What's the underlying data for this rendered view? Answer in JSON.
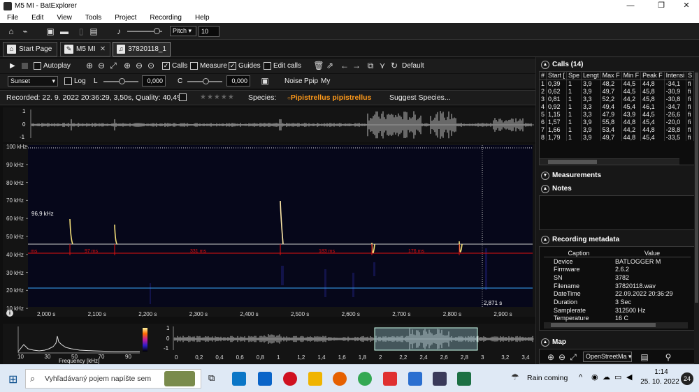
{
  "window": {
    "title": "M5 MI - BatExplorer",
    "minimize": "—",
    "maximize": "❐",
    "close": "✕"
  },
  "menu": [
    "File",
    "Edit",
    "View",
    "Tools",
    "Project",
    "Recording",
    "Help"
  ],
  "toolbar": {
    "pitch_label": "Pitch",
    "pitch_value": "10"
  },
  "tabs": [
    {
      "label": "Start Page"
    },
    {
      "label": "M5 MI"
    },
    {
      "label": "37820118_1"
    }
  ],
  "viewer_toolbar": {
    "autoplay": "Autoplay",
    "calls": "Calls",
    "measure": "Measure",
    "guides": "Guides",
    "edit_calls": "Edit calls",
    "default": "Default",
    "colormap": "Sunset",
    "log": "Log",
    "l_label": "L",
    "l_value": "0,000",
    "c_label": "C",
    "c_value": "0,000",
    "presets": [
      "Noise",
      "Ppip",
      "My"
    ]
  },
  "info": {
    "recorded": "Recorded: 22. 9. 2022 20:36:29, 3,50s, Quality: 40,4%",
    "stars": "★★★★★",
    "species_label": "Species:",
    "species_value": "Pipistrellus pipistrellus",
    "suggest": "Suggest Species..."
  },
  "oscillogram": {
    "ticks": [
      "1",
      "0",
      "-1"
    ]
  },
  "spectrogram": {
    "y_ticks": [
      "100 kHz",
      "90 kHz",
      "80 kHz",
      "70 kHz",
      "60 kHz",
      "50 kHz",
      "40 kHz",
      "30 kHz",
      "20 kHz",
      "10 kHz"
    ],
    "x_ticks": [
      "2,000 s",
      "2,100 s",
      "2,200 s",
      "2,300 s",
      "2,400 s",
      "2,500 s",
      "2,600 s",
      "2,700 s",
      "2,800 s",
      "2,900 s"
    ],
    "peak_label": "96,9 kHz",
    "cursor_label": "2,871 s",
    "interval_labels": [
      "ms",
      "97 ms",
      "331 ms",
      "183 ms",
      "176 ms"
    ]
  },
  "spectrum": {
    "x_ticks": [
      "10",
      "30",
      "50",
      "70",
      "90"
    ],
    "xlabel": "Frequency [kHz]"
  },
  "overview": {
    "y_ticks": [
      "1",
      "0",
      "-1"
    ],
    "x_ticks": [
      "0",
      "0,2",
      "0,4",
      "0,6",
      "0,8",
      "1",
      "1,2",
      "1,4",
      "1,6",
      "1,8",
      "2",
      "2,2",
      "2,4",
      "2,6",
      "2,8",
      "3",
      "3,2",
      "3,4"
    ]
  },
  "calls_panel": {
    "title": "Calls (14)",
    "columns": [
      "#",
      "Start [",
      "Spe",
      "Lengt",
      "Max F",
      "Min F",
      "Peak F",
      "Intensi",
      "S"
    ],
    "rows": [
      [
        "1",
        "0,39",
        "1",
        "3,9",
        "48,2",
        "44,5",
        "44,8",
        "-34,1",
        "fi"
      ],
      [
        "2",
        "0,62",
        "1",
        "3,9",
        "49,7",
        "44,5",
        "45,8",
        "-30,9",
        "fi"
      ],
      [
        "3",
        "0,81",
        "1",
        "3,3",
        "52,2",
        "44,2",
        "45,8",
        "-30,8",
        "fi"
      ],
      [
        "4",
        "0,92",
        "1",
        "3,3",
        "49,4",
        "45,4",
        "46,1",
        "-34,7",
        "fi"
      ],
      [
        "5",
        "1,15",
        "1",
        "3,3",
        "47,9",
        "43,9",
        "44,5",
        "-26,6",
        "fi"
      ],
      [
        "6",
        "1,57",
        "1",
        "3,9",
        "55,8",
        "44,8",
        "45,4",
        "-20,0",
        "fi"
      ],
      [
        "7",
        "1,66",
        "1",
        "3,9",
        "53,4",
        "44,2",
        "44,8",
        "-28,8",
        "fi"
      ],
      [
        "8",
        "1,79",
        "1",
        "3,9",
        "49,7",
        "44,8",
        "45,4",
        "-33,5",
        "fi"
      ]
    ]
  },
  "measurements_panel": {
    "title": "Measurements"
  },
  "notes_panel": {
    "title": "Notes"
  },
  "metadata_panel": {
    "title": "Recording metadata",
    "columns": [
      "Caption",
      "Value"
    ],
    "rows": [
      [
        "Device",
        "BATLOGGER M"
      ],
      [
        "Firmware",
        "2.6.2"
      ],
      [
        "SN",
        "3782"
      ],
      [
        "Filename",
        "37820118.wav"
      ],
      [
        "DateTime",
        "22.09.2022 20:36:29"
      ],
      [
        "Duration",
        "3 Sec"
      ],
      [
        "Samplerate",
        "312500 Hz"
      ],
      [
        "Temperature",
        "16 C"
      ]
    ]
  },
  "map_panel": {
    "title": "Map",
    "provider": "OpenStreetMa"
  },
  "taskbar": {
    "search_placeholder": "Vyhľadávaný pojem napíšte sem",
    "weather": "Rain coming",
    "time": "1:14",
    "date": "25. 10. 2022",
    "notif_count": "24",
    "colors": {
      "edge": "#0a76c7",
      "firefox": "#e66000",
      "chrome": "#34a853",
      "opera": "#d01020",
      "explorer": "#f0b400",
      "excel": "#1d7044",
      "mail": "#0a64c8"
    }
  },
  "colors": {
    "accent_species": "#ff9a1a",
    "guide_red": "#e01010",
    "guide_blue": "#3aa8ff",
    "bg": "#0f0f0f"
  }
}
